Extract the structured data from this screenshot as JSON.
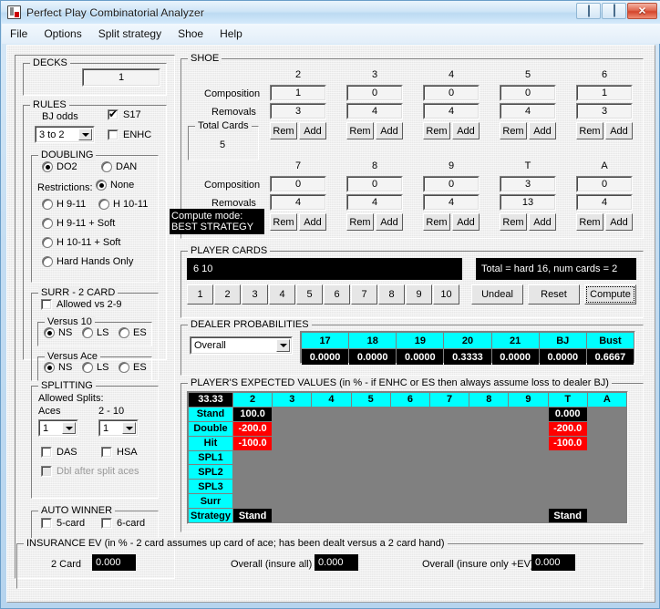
{
  "window": {
    "title": "Perfect Play Combinatorial Analyzer",
    "icon": "cards-icon",
    "controls": {
      "minimize": "minimize-button",
      "maximize": "maximize-button",
      "close": "✕"
    }
  },
  "menu": {
    "items": [
      "File",
      "Options",
      "Split strategy",
      "Shoe",
      "Help"
    ]
  },
  "decks": {
    "title": "DECKS",
    "value": "1"
  },
  "rules": {
    "title": "RULES",
    "bj_odds_label": "BJ odds",
    "bj_odds_value": "3 to 2",
    "s17_label": "S17",
    "s17_checked": true,
    "enhc_label": "ENHC",
    "enhc_checked": false,
    "doubling": {
      "title": "DOUBLING",
      "do2_label": "DO2",
      "dan_label": "DAN",
      "restrictions_label": "Restrictions:",
      "none_label": "None",
      "h911_label": "H 9-11",
      "h1011_label": "H 10-11",
      "h911soft_label": "H 9-11 + Soft",
      "h1011soft_label": "H 10-11 + Soft",
      "hardonly_label": "Hard Hands Only",
      "selected_mode": "DO2",
      "selected_restriction": "None"
    }
  },
  "surrender": {
    "title": "SURR - 2 CARD",
    "allowed_label": "Allowed vs 2-9",
    "allowed_checked": false,
    "versus10": {
      "title": "Versus 10",
      "options": [
        "NS",
        "LS",
        "ES"
      ],
      "selected": "NS"
    },
    "versusace": {
      "title": "Versus Ace",
      "options": [
        "NS",
        "LS",
        "ES"
      ],
      "selected": "NS"
    }
  },
  "splitting": {
    "title": "SPLITTING",
    "allowed_splits_label": "Allowed Splits:",
    "aces_label": "Aces",
    "aces_value": "1",
    "two_ten_label": "2 - 10",
    "two_ten_value": "1",
    "das_label": "DAS",
    "das_checked": false,
    "hsa_label": "HSA",
    "hsa_checked": false,
    "dbl_after_split_label": "Dbl after split aces",
    "dbl_after_split_checked": false,
    "dbl_after_split_disabled": true
  },
  "auto_winner": {
    "title": "AUTO WINNER",
    "five_card_label": "5-card",
    "five_card_checked": false,
    "six_card_label": "6-card",
    "six_card_checked": false
  },
  "shoe": {
    "title": "SHOE",
    "composition_label": "Composition",
    "removals_label": "Removals",
    "rem_button": "Rem",
    "add_button": "Add",
    "total_cards_label": "Total Cards",
    "total_cards_value": "5",
    "compute_mode_line1": "Compute mode:",
    "compute_mode_line2": "BEST STRATEGY",
    "row1": [
      {
        "rank": "2",
        "composition": "1",
        "removals": "3"
      },
      {
        "rank": "3",
        "composition": "0",
        "removals": "4"
      },
      {
        "rank": "4",
        "composition": "0",
        "removals": "4"
      },
      {
        "rank": "5",
        "composition": "0",
        "removals": "4"
      },
      {
        "rank": "6",
        "composition": "1",
        "removals": "3"
      }
    ],
    "row2": [
      {
        "rank": "7",
        "composition": "0",
        "removals": "4"
      },
      {
        "rank": "8",
        "composition": "0",
        "removals": "4"
      },
      {
        "rank": "9",
        "composition": "0",
        "removals": "4"
      },
      {
        "rank": "T",
        "composition": "3",
        "removals": "13"
      },
      {
        "rank": "A",
        "composition": "0",
        "removals": "4"
      }
    ]
  },
  "player_cards": {
    "title": "PLAYER CARDS",
    "hand": "6 10",
    "total_text": "Total = hard 16, num cards = 2",
    "card_buttons": [
      "1",
      "2",
      "3",
      "4",
      "5",
      "6",
      "7",
      "8",
      "9",
      "10"
    ],
    "undeal_label": "Undeal",
    "reset_label": "Reset",
    "compute_label": "Compute"
  },
  "dealer_probabilities": {
    "title": "DEALER PROBABILITIES",
    "selector_value": "Overall",
    "headers": [
      "17",
      "18",
      "19",
      "20",
      "21",
      "BJ",
      "Bust"
    ],
    "values": [
      "0.0000",
      "0.0000",
      "0.0000",
      "0.3333",
      "0.0000",
      "0.0000",
      "0.6667"
    ]
  },
  "expected_values": {
    "title": "PLAYER'S EXPECTED VALUES (in % - if ENHC or ES then always assume loss to dealer BJ)",
    "corner_value": "33.33",
    "columns": [
      "2",
      "3",
      "4",
      "5",
      "6",
      "7",
      "8",
      "9",
      "T",
      "A"
    ],
    "rows": [
      {
        "label": "Stand",
        "cells": [
          "100.0",
          "",
          "",
          "",
          "",
          "",
          "",
          "",
          "0.000",
          ""
        ],
        "styles": [
          "black",
          "empty",
          "empty",
          "empty",
          "empty",
          "empty",
          "empty",
          "empty",
          "black",
          "empty"
        ]
      },
      {
        "label": "Double",
        "cells": [
          "-200.0",
          "",
          "",
          "",
          "",
          "",
          "",
          "",
          "-200.0",
          ""
        ],
        "styles": [
          "red",
          "empty",
          "empty",
          "empty",
          "empty",
          "empty",
          "empty",
          "empty",
          "red",
          "empty"
        ]
      },
      {
        "label": "Hit",
        "cells": [
          "-100.0",
          "",
          "",
          "",
          "",
          "",
          "",
          "",
          "-100.0",
          ""
        ],
        "styles": [
          "red",
          "empty",
          "empty",
          "empty",
          "empty",
          "empty",
          "empty",
          "empty",
          "red",
          "empty"
        ]
      },
      {
        "label": "SPL1",
        "cells": [
          "",
          "",
          "",
          "",
          "",
          "",
          "",
          "",
          "",
          ""
        ],
        "styles": [
          "empty",
          "empty",
          "empty",
          "empty",
          "empty",
          "empty",
          "empty",
          "empty",
          "empty",
          "empty"
        ]
      },
      {
        "label": "SPL2",
        "cells": [
          "",
          "",
          "",
          "",
          "",
          "",
          "",
          "",
          "",
          ""
        ],
        "styles": [
          "empty",
          "empty",
          "empty",
          "empty",
          "empty",
          "empty",
          "empty",
          "empty",
          "empty",
          "empty"
        ]
      },
      {
        "label": "SPL3",
        "cells": [
          "",
          "",
          "",
          "",
          "",
          "",
          "",
          "",
          "",
          ""
        ],
        "styles": [
          "empty",
          "empty",
          "empty",
          "empty",
          "empty",
          "empty",
          "empty",
          "empty",
          "empty",
          "empty"
        ]
      },
      {
        "label": "Surr",
        "cells": [
          "",
          "",
          "",
          "",
          "",
          "",
          "",
          "",
          "",
          ""
        ],
        "styles": [
          "empty",
          "empty",
          "empty",
          "empty",
          "empty",
          "empty",
          "empty",
          "empty",
          "empty",
          "empty"
        ]
      },
      {
        "label": "Strategy",
        "cells": [
          "Stand",
          "",
          "",
          "",
          "",
          "",
          "",
          "",
          "Stand",
          ""
        ],
        "styles": [
          "black",
          "empty",
          "empty",
          "empty",
          "empty",
          "empty",
          "empty",
          "empty",
          "black",
          "empty"
        ]
      }
    ]
  },
  "insurance": {
    "title": "INSURANCE EV (in % - 2 card assumes up card of ace; has been dealt versus a 2 card hand)",
    "two_card_label": "2 Card",
    "two_card_value": "0.000",
    "overall_all_label": "Overall (insure all)",
    "overall_all_value": "0.000",
    "overall_pos_label": "Overall (insure only +EV)",
    "overall_pos_value": "0.000"
  },
  "colors": {
    "cyan": "#00ffff",
    "red": "#ff0000",
    "black": "#000000",
    "gray": "#808080",
    "face": "#efefef"
  }
}
